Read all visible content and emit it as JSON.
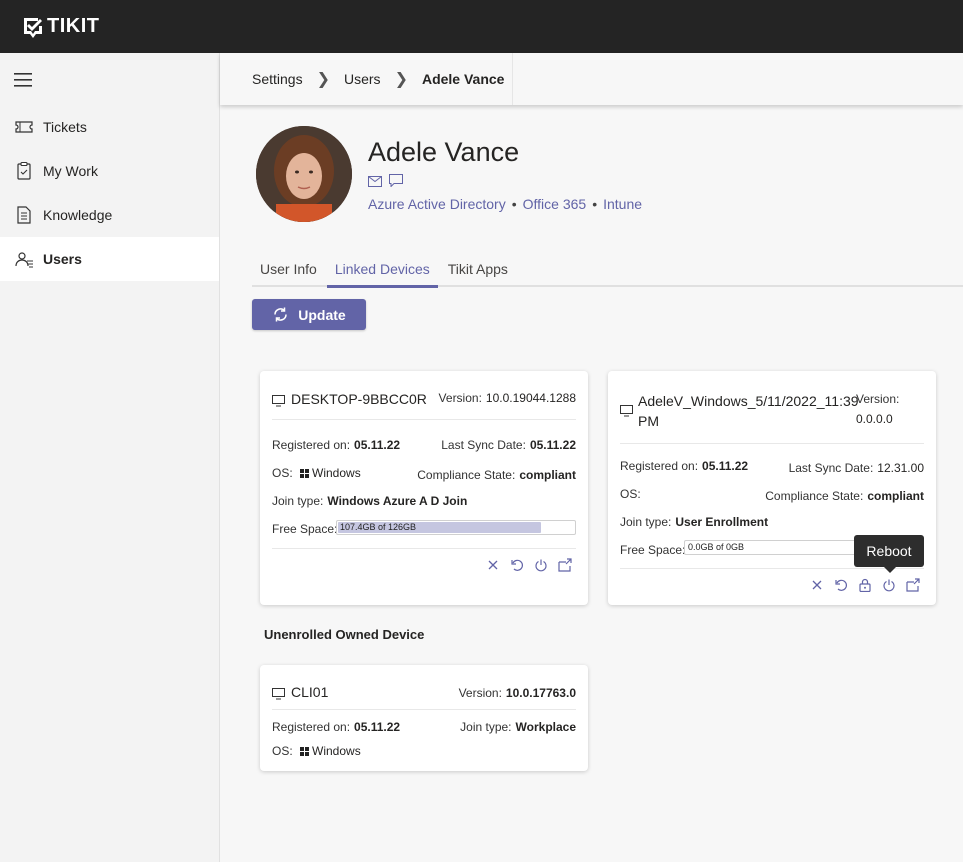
{
  "app": {
    "name": "TIKIT"
  },
  "sidebar": {
    "items": [
      {
        "label": "Tickets",
        "icon": "ticket-icon"
      },
      {
        "label": "My Work",
        "icon": "clipboard-icon"
      },
      {
        "label": "Knowledge",
        "icon": "document-icon"
      },
      {
        "label": "Users",
        "icon": "users-icon",
        "active": true
      }
    ]
  },
  "breadcrumb": {
    "items": [
      "Settings",
      "Users",
      "Adele Vance"
    ]
  },
  "user": {
    "name": "Adele Vance",
    "sources": [
      "Azure Active Directory",
      "Office 365",
      "Intune"
    ]
  },
  "tabs": [
    {
      "label": "User Info"
    },
    {
      "label": "Linked Devices",
      "active": true
    },
    {
      "label": "Tikit Apps"
    }
  ],
  "update_button": {
    "label": "Update"
  },
  "labels": {
    "version": "Version:",
    "registered": "Registered on:",
    "last_sync": "Last Sync Date:",
    "os": "OS:",
    "compliance": "Compliance State:",
    "join_type": "Join type:",
    "free_space": "Free Space:"
  },
  "devices": [
    {
      "name": "DESKTOP-9BBCC0R",
      "version": "10.0.19044.1288",
      "registered": "05.11.22",
      "last_sync": "05.11.22",
      "os": "Windows",
      "compliance": "compliant",
      "join_type": "Windows Azure A D Join",
      "free_space": "107.4GB of 126GB",
      "free_space_fraction": 0.852
    },
    {
      "name_line1": "AdeleV_Windows_5/11/2022_11:39",
      "name_line2": "PM",
      "version": "0.0.0.0",
      "registered": "05.11.22",
      "last_sync": "12.31.00",
      "os": "",
      "compliance": "compliant",
      "join_type": "User Enrollment",
      "free_space": "0.0GB of 0GB",
      "free_space_fraction": 0
    }
  ],
  "unenrolled": {
    "title": "Unenrolled Owned Device",
    "device": {
      "name": "CLI01",
      "version": "10.0.17763.0",
      "registered": "05.11.22",
      "join_type": "Workplace",
      "os": "Windows"
    }
  },
  "tooltip": {
    "text": "Reboot"
  },
  "colors": {
    "accent": "#6264a7",
    "topbar": "#242424",
    "progress_fill": "#c5c6e0"
  }
}
